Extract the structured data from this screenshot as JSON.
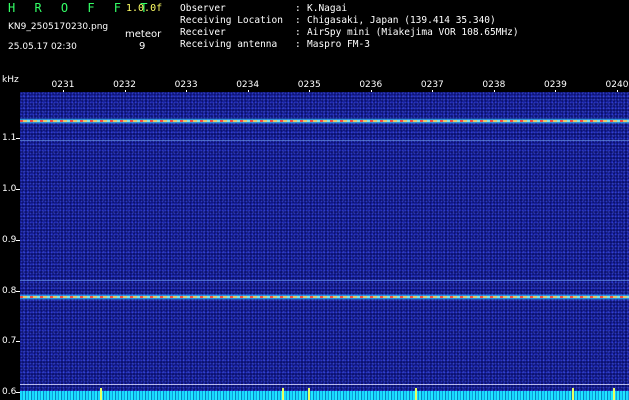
{
  "header": {
    "app_title": "H R O F F T",
    "version": "1.0.0f",
    "filename": "KN9_2505170230.png",
    "meteor_label": "meteor",
    "datetime": "25.05.17 02:30",
    "meteor_count": "9"
  },
  "info": [
    {
      "key": "Observer",
      "sep": ":",
      "value": "K.Nagai"
    },
    {
      "key": "Receiving Location",
      "sep": ":",
      "value": "Chigasaki, Japan (139.414 35.340)"
    },
    {
      "key": "Receiver",
      "sep": ":",
      "value": "AirSpy mini (Miakejima VOR 108.65MHz)"
    },
    {
      "key": "Receiving antenna",
      "sep": ":",
      "value": "Maspro FM-3"
    }
  ],
  "spectrogram": {
    "y_unit": "kHz",
    "y_ticks": [
      "1.1",
      "1.0",
      "0.9",
      "0.8",
      "0.7",
      "0.6"
    ],
    "y_range": [
      0.585,
      1.19
    ],
    "x_ticks": [
      "0231",
      "0232",
      "0233",
      "0234",
      "0235",
      "0236",
      "0237",
      "0238",
      "0239",
      "0240"
    ],
    "signal_bands_khz": [
      1.133,
      0.787
    ],
    "faint_lines_khz": [
      1.095,
      0.821,
      0.617,
      0.603
    ],
    "colors": {
      "background": "#0a0f6a",
      "band": "#ffe060",
      "noise_floor": "#18d8ff",
      "label_text": "#ffffff",
      "title_text": "#33ff66",
      "version_text": "#ffff66"
    }
  }
}
